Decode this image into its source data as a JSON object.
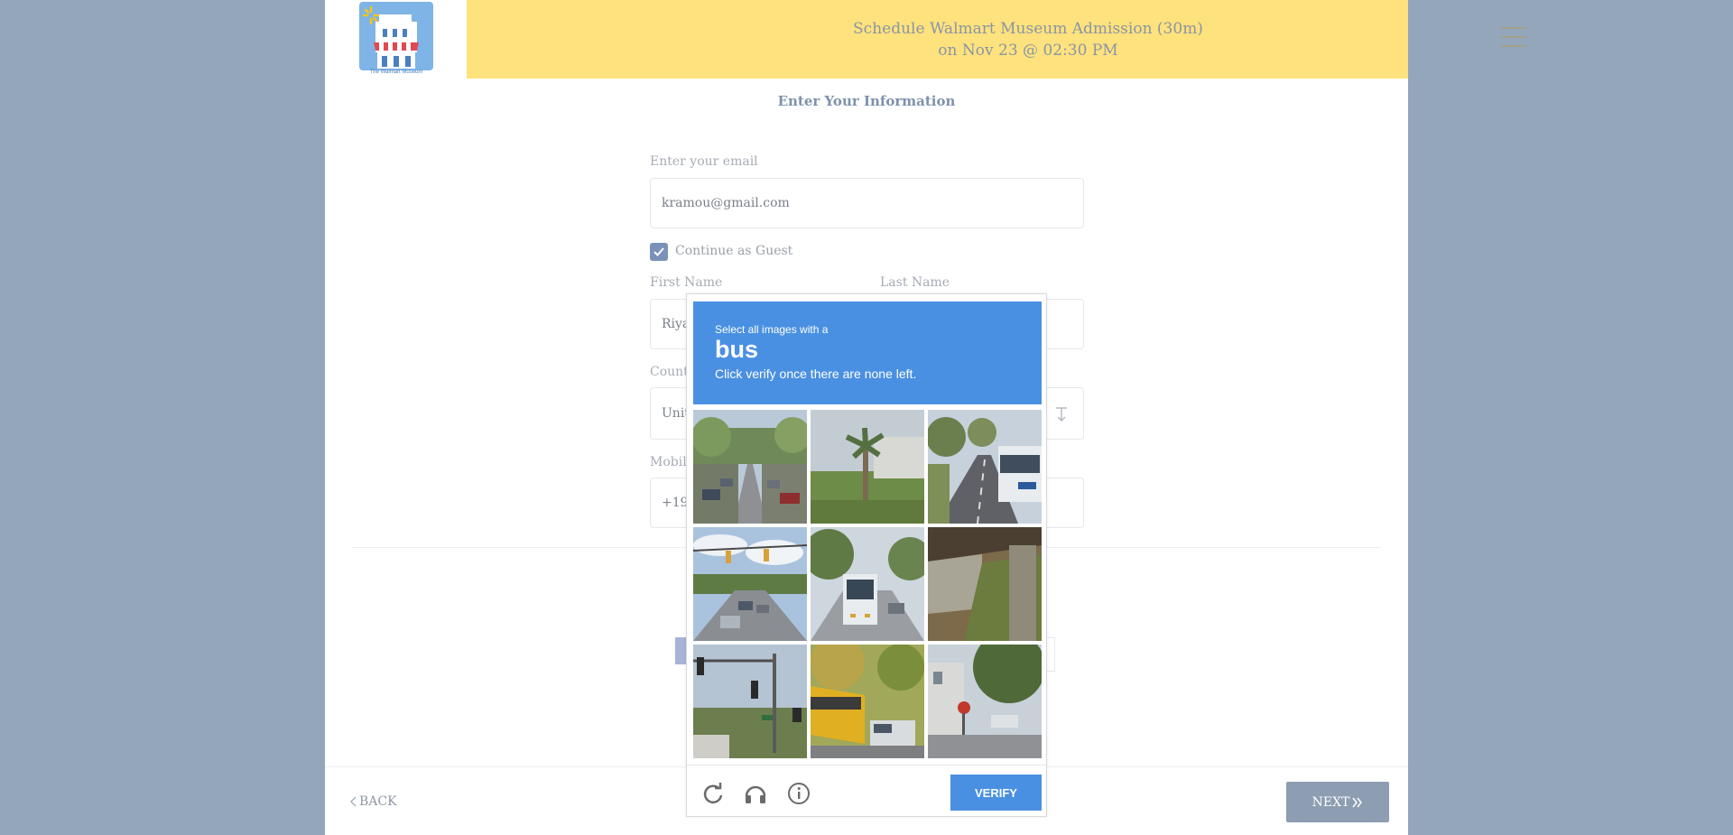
{
  "header": {
    "title_line1": "Schedule Walmart Museum Admission (30m)",
    "title_line2": "on Nov 23 @ 02:30 PM",
    "logo_caption": "The Walmart Museum"
  },
  "form": {
    "section_title": "Enter Your Information",
    "email_label": "Enter your email",
    "email_value": "kramou@gmail.com",
    "guest_label": "Continue as Guest",
    "guest_checked": true,
    "first_name_label": "First Name",
    "first_name_value": "Riya",
    "last_name_label": "Last Name",
    "last_name_value": "",
    "country_label": "Countr",
    "country_value": "Unit",
    "mobile_label": "Mobile",
    "mobile_value": "+19"
  },
  "captcha": {
    "instruction_line1": "Select all images with a",
    "target": "bus",
    "instruction_line2": "Click verify once there are none left.",
    "verify_label": "VERIFY",
    "tiles": [
      {
        "name": "tile-street-parked-cars"
      },
      {
        "name": "tile-palm-tree"
      },
      {
        "name": "tile-road-with-bus"
      },
      {
        "name": "tile-traffic-light-road"
      },
      {
        "name": "tile-bus-on-road"
      },
      {
        "name": "tile-overpass"
      },
      {
        "name": "tile-traffic-signals"
      },
      {
        "name": "tile-school-bus"
      },
      {
        "name": "tile-street-corner"
      }
    ]
  },
  "nav": {
    "back_label": "BACK",
    "next_label": "NEXT"
  },
  "colors": {
    "header_bg": "#fee27d",
    "page_bg": "#93a6bb",
    "captcha_blue": "#4a90e2",
    "next_button": "#8d9db2",
    "checkbox": "#7a92b8"
  }
}
